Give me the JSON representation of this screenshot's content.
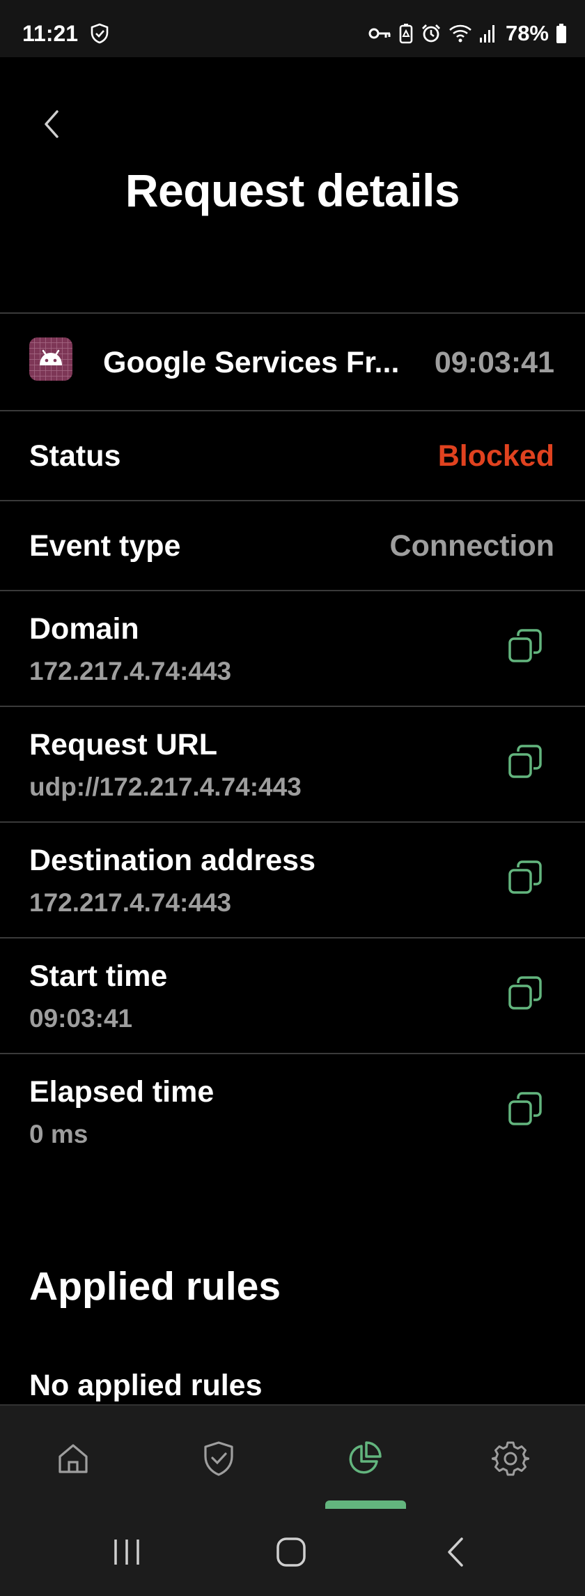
{
  "status_bar": {
    "time": "11:21",
    "battery": "78%",
    "icons": [
      "shield-icon",
      "vpn-key-icon",
      "battery-saver-icon",
      "alarm-icon",
      "wifi-icon",
      "signal-icon",
      "battery-icon"
    ]
  },
  "header": {
    "back_icon": "chevron-left-icon",
    "title": "Request details"
  },
  "app": {
    "icon": "android-icon",
    "name": "Google Services Fr...",
    "time": "09:03:41"
  },
  "status": {
    "label": "Status",
    "value": "Blocked",
    "color": "#e0421f"
  },
  "event_type": {
    "label": "Event type",
    "value": "Connection"
  },
  "details": [
    {
      "label": "Domain",
      "value": "172.217.4.74:443"
    },
    {
      "label": "Request URL",
      "value": "udp://172.217.4.74:443"
    },
    {
      "label": "Destination address",
      "value": "172.217.4.74:443"
    },
    {
      "label": "Start time",
      "value": "09:03:41"
    },
    {
      "label": "Elapsed time",
      "value": "0 ms"
    }
  ],
  "applied_rules": {
    "title": "Applied rules",
    "empty": "No applied rules"
  },
  "bottom_nav": {
    "items": [
      "home-icon",
      "protection-shield-icon",
      "statistics-pie-icon",
      "settings-gear-icon"
    ],
    "active_index": 2,
    "accent": "#63b57e"
  },
  "system_nav": [
    "recents-icon",
    "home-icon",
    "back-icon"
  ]
}
